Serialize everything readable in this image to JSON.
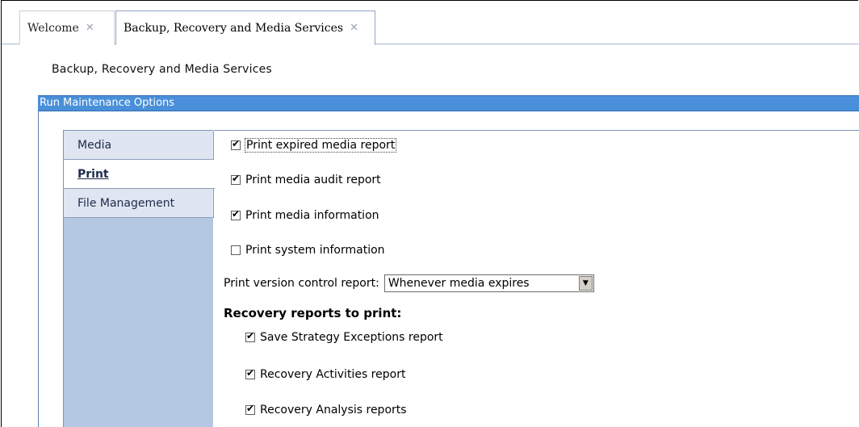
{
  "tabs": [
    {
      "label": "Welcome",
      "close": "✕"
    },
    {
      "label": "Backup, Recovery and Media Services",
      "close": "✕"
    }
  ],
  "page_title": "Backup, Recovery and Media Services",
  "section_header": "Run Maintenance Options",
  "sidenav": [
    {
      "label": "Media"
    },
    {
      "label": "Print"
    },
    {
      "label": "File Management"
    }
  ],
  "options": [
    {
      "label": "Print expired media report",
      "checked": true
    },
    {
      "label": "Print media audit report",
      "checked": true
    },
    {
      "label": "Print media information",
      "checked": true
    },
    {
      "label": "Print system information",
      "checked": false
    }
  ],
  "version_control": {
    "label": "Print version control report:",
    "value": "Whenever media expires"
  },
  "recovery_heading": "Recovery reports to print:",
  "recovery_options": [
    {
      "label": "Save Strategy Exceptions report",
      "checked": true
    },
    {
      "label": "Recovery Activities report",
      "checked": true
    },
    {
      "label": "Recovery Analysis reports",
      "checked": true
    }
  ],
  "colors": {
    "header_blue": "#4a8fd9",
    "nav_bg": "#b4c7e3"
  }
}
